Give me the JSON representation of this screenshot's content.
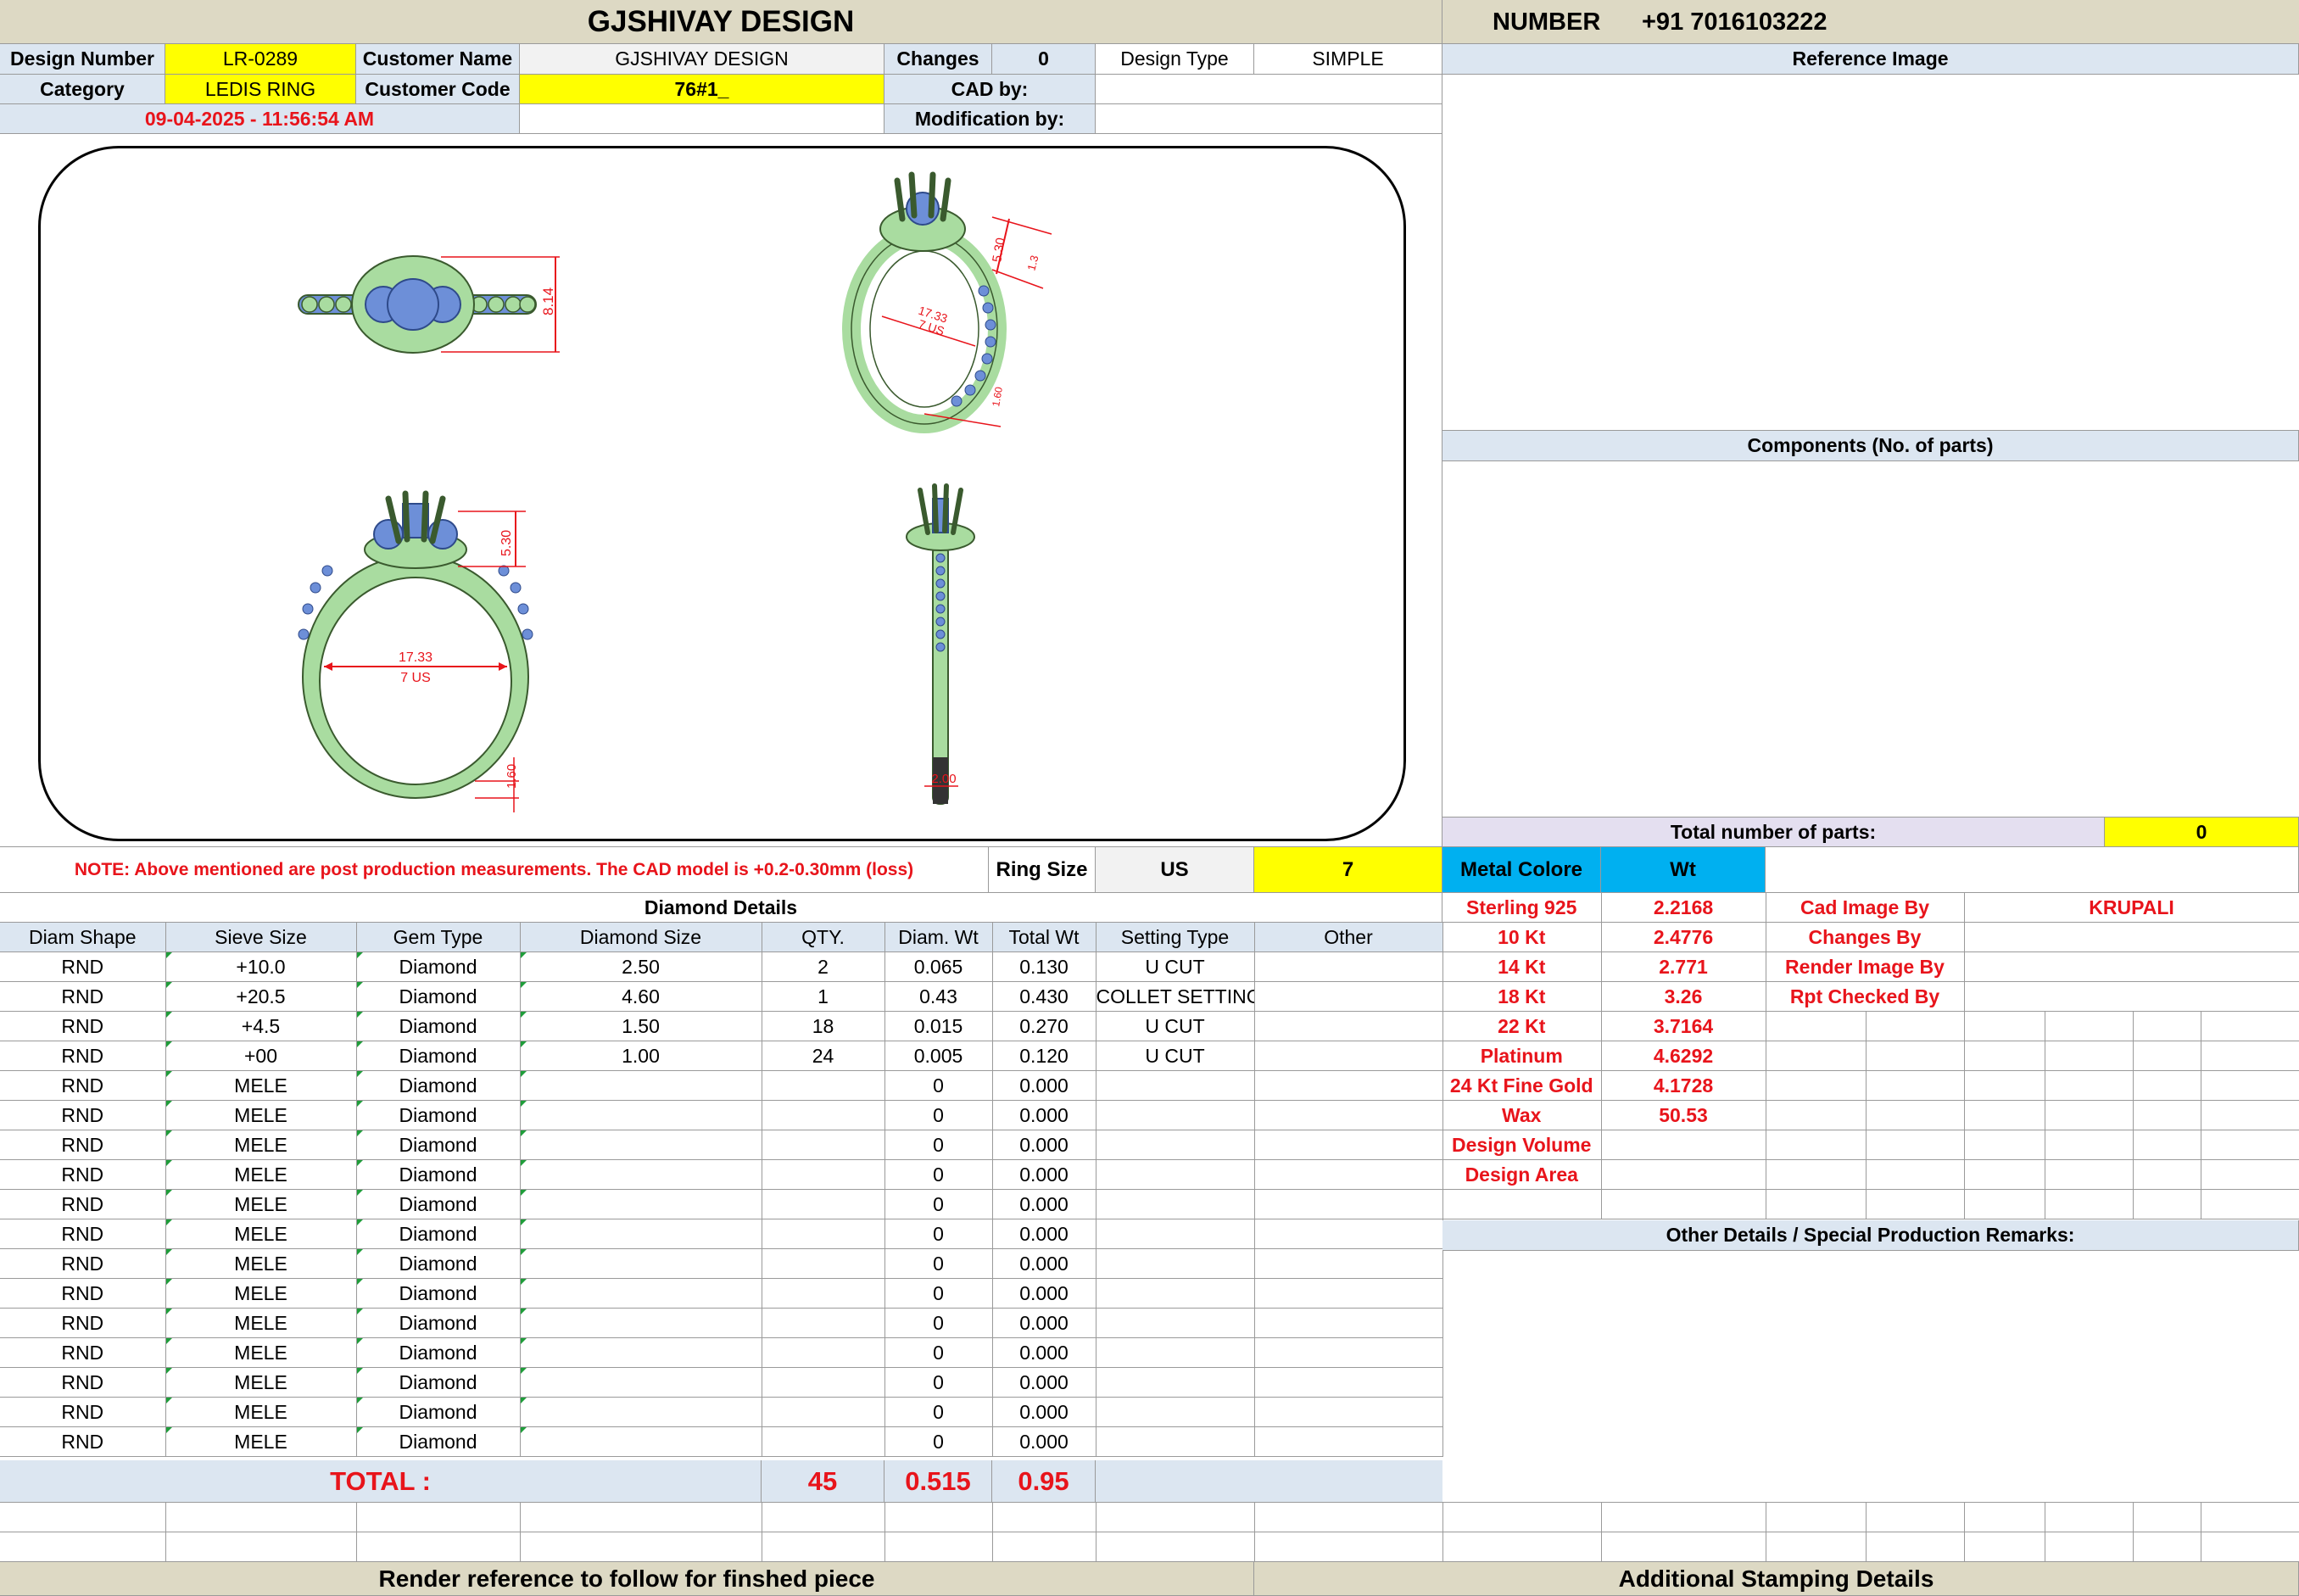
{
  "header": {
    "title": "GJSHIVAY DESIGN",
    "number_label": "NUMBER",
    "number_value": "+91 7016103222"
  },
  "info": {
    "design_number_label": "Design Number",
    "design_number": "LR-0289",
    "customer_name_label": "Customer Name",
    "customer_name": "GJSHIVAY DESIGN",
    "changes_label": "Changes",
    "changes": "0",
    "design_type_label": "Design Type",
    "design_type": "SIMPLE",
    "category_label": "Category",
    "category": "LEDIS RING",
    "customer_code_label": "Customer Code",
    "customer_code": "76#1_",
    "cad_by_label": "CAD by:",
    "modification_by_label": "Modification by:",
    "datetime": "09-04-2025 - 11:56:54 AM"
  },
  "drawing": {
    "dims": {
      "top_height": "8.14",
      "persp_top": "5.30",
      "persp_side": "1.3",
      "persp_inner": "17.33",
      "persp_inner_us": "7 US",
      "persp_bottom": "1.60",
      "front_height": "5.30",
      "front_inner": "17.33",
      "front_inner_us": "7 US",
      "front_band": "1.60",
      "side_width": "2.00"
    }
  },
  "note": "NOTE: Above mentioned are post production measurements. The CAD model is +0.2-0.30mm (loss)",
  "ring_size": {
    "label": "Ring Size",
    "system": "US",
    "value": "7"
  },
  "diamond": {
    "title": "Diamond Details",
    "headers": [
      "Diam Shape",
      "Sieve Size",
      "Gem Type",
      "Diamond Size",
      "QTY.",
      "Diam. Wt",
      "Total Wt",
      "Setting Type",
      "Other"
    ],
    "rows": [
      [
        "RND",
        "+10.0",
        "Diamond",
        "2.50",
        "2",
        "0.065",
        "0.130",
        "U CUT",
        ""
      ],
      [
        "RND",
        "+20.5",
        "Diamond",
        "4.60",
        "1",
        "0.43",
        "0.430",
        "COLLET SETTING",
        ""
      ],
      [
        "RND",
        "+4.5",
        "Diamond",
        "1.50",
        "18",
        "0.015",
        "0.270",
        "U CUT",
        ""
      ],
      [
        "RND",
        "+00",
        "Diamond",
        "1.00",
        "24",
        "0.005",
        "0.120",
        "U CUT",
        ""
      ],
      [
        "RND",
        "MELE",
        "Diamond",
        "",
        "",
        "0",
        "0.000",
        "",
        ""
      ],
      [
        "RND",
        "MELE",
        "Diamond",
        "",
        "",
        "0",
        "0.000",
        "",
        ""
      ],
      [
        "RND",
        "MELE",
        "Diamond",
        "",
        "",
        "0",
        "0.000",
        "",
        ""
      ],
      [
        "RND",
        "MELE",
        "Diamond",
        "",
        "",
        "0",
        "0.000",
        "",
        ""
      ],
      [
        "RND",
        "MELE",
        "Diamond",
        "",
        "",
        "0",
        "0.000",
        "",
        ""
      ],
      [
        "RND",
        "MELE",
        "Diamond",
        "",
        "",
        "0",
        "0.000",
        "",
        ""
      ],
      [
        "RND",
        "MELE",
        "Diamond",
        "",
        "",
        "0",
        "0.000",
        "",
        ""
      ],
      [
        "RND",
        "MELE",
        "Diamond",
        "",
        "",
        "0",
        "0.000",
        "",
        ""
      ],
      [
        "RND",
        "MELE",
        "Diamond",
        "",
        "",
        "0",
        "0.000",
        "",
        ""
      ],
      [
        "RND",
        "MELE",
        "Diamond",
        "",
        "",
        "0",
        "0.000",
        "",
        ""
      ],
      [
        "RND",
        "MELE",
        "Diamond",
        "",
        "",
        "0",
        "0.000",
        "",
        ""
      ],
      [
        "RND",
        "MELE",
        "Diamond",
        "",
        "",
        "0",
        "0.000",
        "",
        ""
      ],
      [
        "RND",
        "MELE",
        "Diamond",
        "",
        "",
        "0",
        "0.000",
        "",
        ""
      ]
    ],
    "total_label": "TOTAL :",
    "total_qty": "45",
    "total_diam_wt": "0.515",
    "total_wt": "0.95"
  },
  "right": {
    "reference_image_title": "Reference Image",
    "components_title": "Components (No. of parts)",
    "total_parts_label": "Total number of parts:",
    "total_parts": "0",
    "metal_colore_label": "Metal Colore",
    "wt_label": "Wt",
    "metals": [
      {
        "name": "Sterling 925",
        "wt": "2.2168"
      },
      {
        "name": "10 Kt",
        "wt": "2.4776"
      },
      {
        "name": "14 Kt",
        "wt": "2.771"
      },
      {
        "name": "18 Kt",
        "wt": "3.26"
      },
      {
        "name": "22 Kt",
        "wt": "3.7164"
      },
      {
        "name": "Platinum",
        "wt": "4.6292"
      },
      {
        "name": "24 Kt Fine Gold",
        "wt": "4.1728"
      },
      {
        "name": "Wax",
        "wt": "50.53"
      },
      {
        "name": "Design Volume",
        "wt": ""
      },
      {
        "name": "Design Area",
        "wt": ""
      }
    ],
    "credits": [
      {
        "label": "Cad Image By",
        "value": "KRUPALI"
      },
      {
        "label": "Changes By",
        "value": ""
      },
      {
        "label": "Render Image By",
        "value": ""
      },
      {
        "label": "Rpt Checked By",
        "value": ""
      }
    ],
    "other_details_title": "Other Details / Special Production Remarks:"
  },
  "footer": {
    "render_reference": "Render reference to follow for finshed piece",
    "stamping": "Additional Stamping Details"
  },
  "colors": {
    "red": "#e8141b",
    "yellow": "#ffff00",
    "light_blue": "#dce6f1",
    "cyan": "#00b0f0",
    "beige": "#ddd9c4",
    "ring_green": "#a9dca0",
    "stone_blue": "#6d8fd8"
  }
}
